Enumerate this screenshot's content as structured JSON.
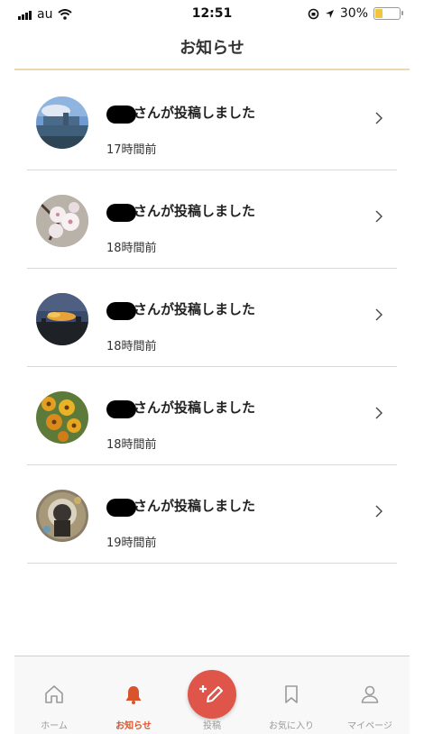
{
  "status_bar": {
    "carrier": "au",
    "time": "12:51",
    "battery": "30%",
    "battery_level": 0.3
  },
  "header": {
    "title": "お知らせ"
  },
  "notifications": [
    {
      "title": "さんが投稿しました",
      "time": "17時間前",
      "avatar": "city-river-photo"
    },
    {
      "title": "さんが投稿しました",
      "time": "18時間前",
      "avatar": "cherry-blossom-photo"
    },
    {
      "title": "さんが投稿しました",
      "time": "18時間前",
      "avatar": "sunset-sky-photo"
    },
    {
      "title": "さんが投稿しました",
      "time": "18時間前",
      "avatar": "yellow-flowers-photo"
    },
    {
      "title": "さんが投稿しました",
      "time": "19時間前",
      "avatar": "stone-ornament-photo"
    }
  ],
  "tabs": [
    {
      "label": "ホーム",
      "icon": "home-icon",
      "active": false
    },
    {
      "label": "お知らせ",
      "icon": "bell-icon",
      "active": true
    },
    {
      "label": "投稿",
      "icon": "post-pencil-icon",
      "active": false
    },
    {
      "label": "お気に入り",
      "icon": "bookmark-icon",
      "active": false
    },
    {
      "label": "マイページ",
      "icon": "user-icon",
      "active": false
    }
  ],
  "colors": {
    "accent": "#d9532c",
    "post_button": "#e05549",
    "header_rule": "#ecd8b0",
    "inactive_icon": "#9a9a9a",
    "battery": "#f2c53d"
  }
}
